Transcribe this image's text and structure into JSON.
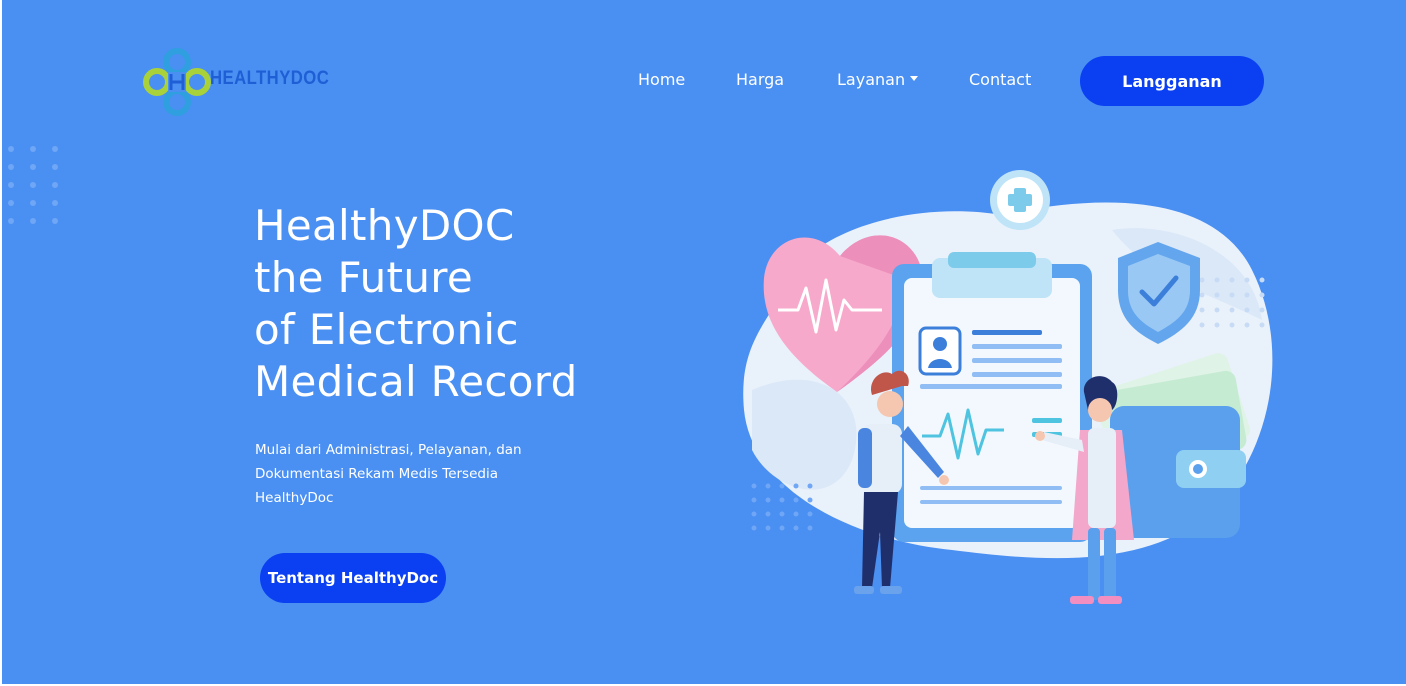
{
  "header": {
    "logo_text": "HEALTHYDOC",
    "nav": {
      "home": "Home",
      "pricing": "Harga",
      "services": "Layanan",
      "contact": "Contact"
    },
    "cta_label": "Langganan"
  },
  "hero": {
    "title_lines": [
      "HealthyDOC",
      "the Future",
      "of Electronic",
      "Medical Record"
    ],
    "subtitle": "Mulai dari Administrasi, Pelayanan, dan Dokumentasi Rekam Medis Tersedia HealthyDoc",
    "button_label": "Tentang HealthyDoc"
  },
  "theme": {
    "background": "#4a8ff2",
    "button": "#0a3ff2",
    "text": "#ffffff",
    "logo_text": "#1f5fd6"
  },
  "icons": [
    "logo-icon",
    "caret-down-icon",
    "plus-icon",
    "heart-icon",
    "shield-check-icon",
    "wallet-icon",
    "clipboard-icon",
    "user-icon",
    "pulse-icon"
  ]
}
